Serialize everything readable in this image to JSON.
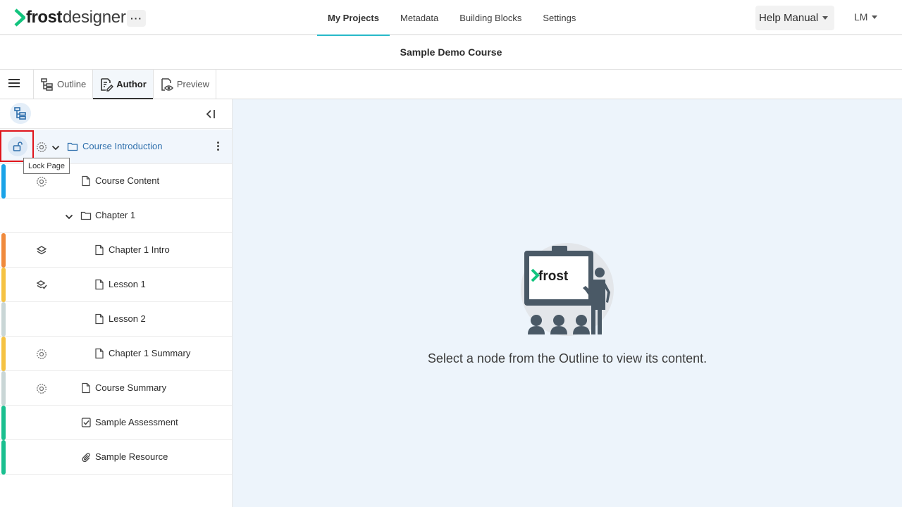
{
  "app": {
    "logo_part1": "frost",
    "logo_part2": "designer",
    "more_label": "···",
    "accent_color": "#27b9c9",
    "logo_green": "#12c47e"
  },
  "nav": {
    "tabs": [
      {
        "label": "My Projects",
        "active": true
      },
      {
        "label": "Metadata",
        "active": false
      },
      {
        "label": "Building Blocks",
        "active": false
      },
      {
        "label": "Settings",
        "active": false
      }
    ],
    "help_label": "Help Manual",
    "user_initials": "LM"
  },
  "course": {
    "title": "Sample Demo Course"
  },
  "modes": [
    {
      "label": "Outline",
      "icon": "outline-tree-icon",
      "active": false
    },
    {
      "label": "Author",
      "icon": "edit-document-icon",
      "active": true
    },
    {
      "label": "Preview",
      "icon": "eye-preview-icon",
      "active": false
    }
  ],
  "tree": {
    "nodes": [
      {
        "label": "Course Introduction",
        "type": "folder",
        "status_icon": "settings-badge-icon",
        "bar_color": "",
        "selected": true,
        "expanded": true
      },
      {
        "label": "Course Content",
        "type": "page",
        "status_icon": "settings-badge-icon",
        "bar_color": "#1aa3e8"
      },
      {
        "label": "Chapter 1",
        "type": "folder",
        "status_icon": "",
        "bar_color": "",
        "expanded": true
      },
      {
        "label": "Chapter 1 Intro",
        "type": "page",
        "status_icon": "layers-icon",
        "bar_color": "#f08a3c"
      },
      {
        "label": "Lesson 1",
        "type": "page",
        "status_icon": "layers-check-icon",
        "bar_color": "#f5c242"
      },
      {
        "label": "Lesson 2",
        "type": "page",
        "status_icon": "",
        "bar_color": "#c9d6d6"
      },
      {
        "label": "Chapter 1 Summary",
        "type": "page",
        "status_icon": "settings-badge-icon",
        "bar_color": "#f5c242"
      },
      {
        "label": "Course Summary",
        "type": "page",
        "status_icon": "settings-badge-icon",
        "bar_color": "#c9d6d6"
      },
      {
        "label": "Sample Assessment",
        "type": "assessment",
        "status_icon": "",
        "bar_color": "#1abf8f"
      },
      {
        "label": "Sample Resource",
        "type": "resource",
        "status_icon": "",
        "bar_color": "#1abf8f"
      }
    ],
    "lock_tooltip": "Lock Page"
  },
  "main": {
    "illustration_text": "frost",
    "empty_message": "Select a node from the Outline to view its content."
  }
}
